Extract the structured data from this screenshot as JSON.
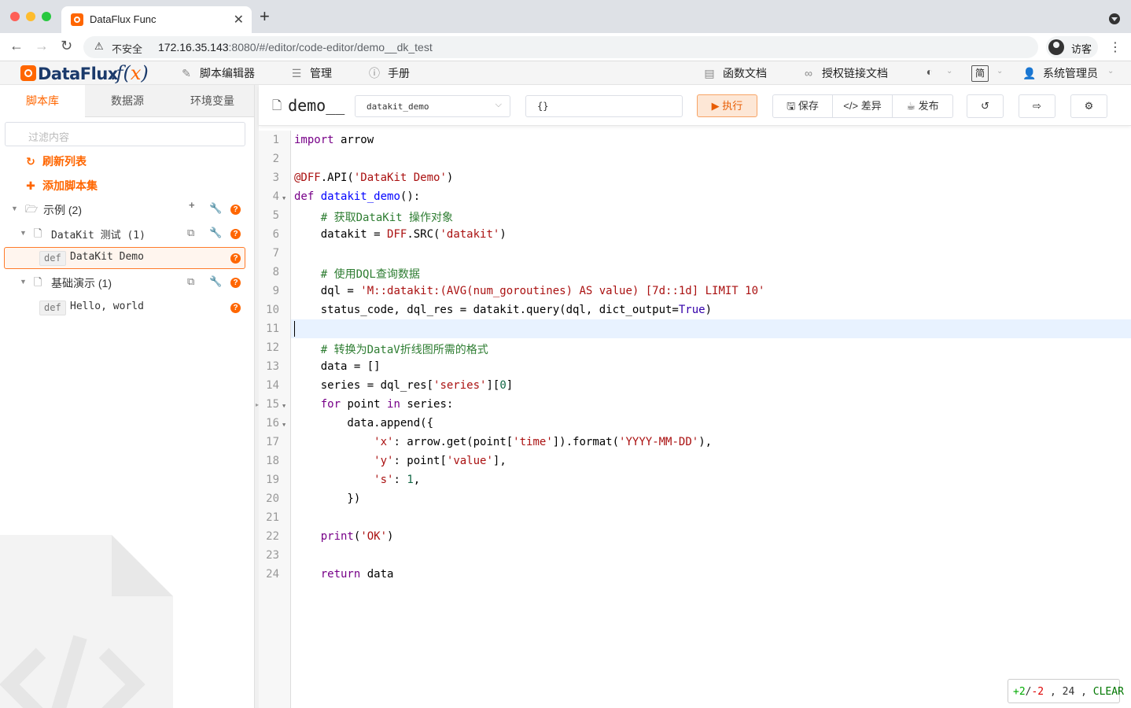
{
  "browser": {
    "tab_title": "DataFlux Func",
    "insecure_label": "不安全",
    "url_host": "172.16.35.143",
    "url_rest": ":8080/#/editor/code-editor/demo__dk_test",
    "profile_name": "访客"
  },
  "header": {
    "logo_text": "DataFlux",
    "logo_fx": ".f(x)",
    "nav": [
      {
        "label": "脚本编辑器",
        "icon": "edit-icon"
      },
      {
        "label": "管理",
        "icon": "list-icon"
      },
      {
        "label": "手册",
        "icon": "help-circle-icon"
      }
    ],
    "right": [
      {
        "label": "函数文档",
        "icon": "book-icon"
      },
      {
        "label": "授权链接文档",
        "icon": "link-icon"
      }
    ],
    "lang_label": "简",
    "user_label": "系统管理员"
  },
  "sidebar": {
    "tabs": [
      "脚本库",
      "数据源",
      "环境变量"
    ],
    "filter_placeholder": "过滤内容",
    "refresh_label": "刷新列表",
    "add_label": "添加脚本集",
    "tree": [
      {
        "label": "示例  (2)"
      },
      {
        "label": "DataKit 测试  (1)"
      },
      {
        "badge": "def",
        "label": "DataKit Demo"
      },
      {
        "label": "基础演示  (1)"
      },
      {
        "badge": "def",
        "label": "Hello, world"
      }
    ]
  },
  "editor": {
    "title": "demo__",
    "script_select": "datakit_demo",
    "args_value": "{}",
    "run_label": "执行",
    "save_label": "保存",
    "diff_label": "差异",
    "publish_label": "发布",
    "line_numbers": [
      "1",
      "2",
      "3",
      "4",
      "5",
      "6",
      "7",
      "8",
      "9",
      "10",
      "11",
      "12",
      "13",
      "14",
      "15",
      "16",
      "17",
      "18",
      "19",
      "20",
      "21",
      "22",
      "23",
      "24"
    ]
  },
  "status": {
    "added": "+2",
    "removed": "-2",
    "line": "24",
    "clear": "CLEAR"
  },
  "colors": {
    "accent": "#ff6600",
    "brand": "#1b3a6b",
    "active_line": "#e8f2ff"
  }
}
